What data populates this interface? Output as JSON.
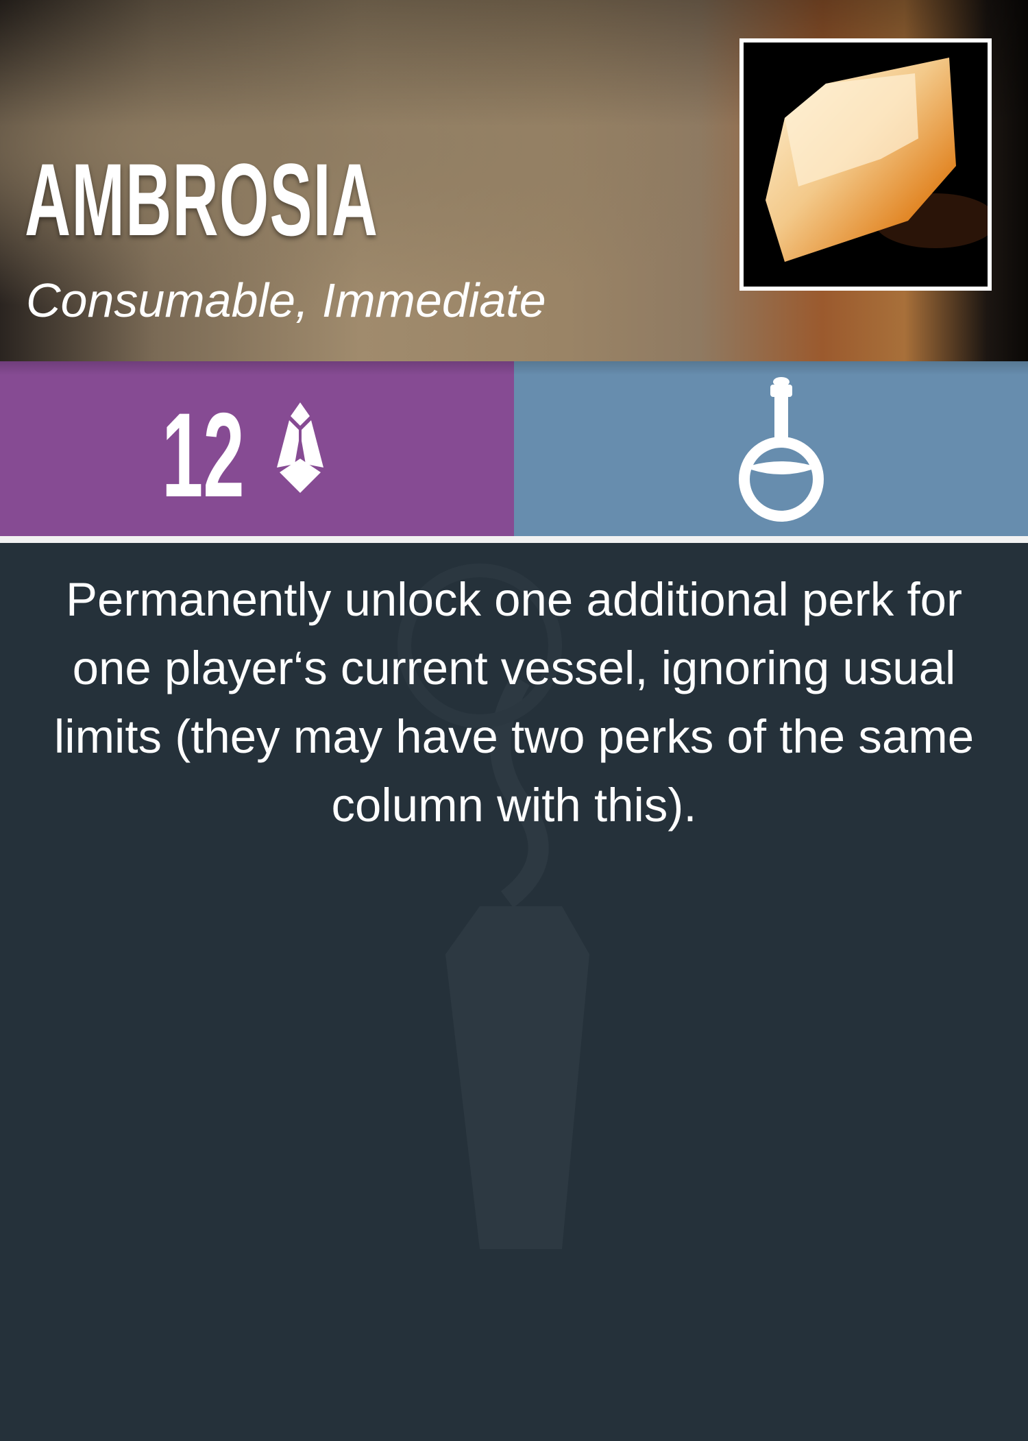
{
  "card": {
    "title": "AMBROSIA",
    "subtitle": "Consumable, Immediate",
    "image": "amber-crystal",
    "cost": {
      "value": "12",
      "icon": "crystal-icon",
      "color": "#864b93"
    },
    "type": {
      "icon": "potion-flask-icon",
      "color": "#678dae"
    },
    "description": "Permanently unlock one additional perk for one player‘s current vessel, ignoring usual limits (they may have two perks of the same column with this).",
    "background_color": "#25313a"
  }
}
